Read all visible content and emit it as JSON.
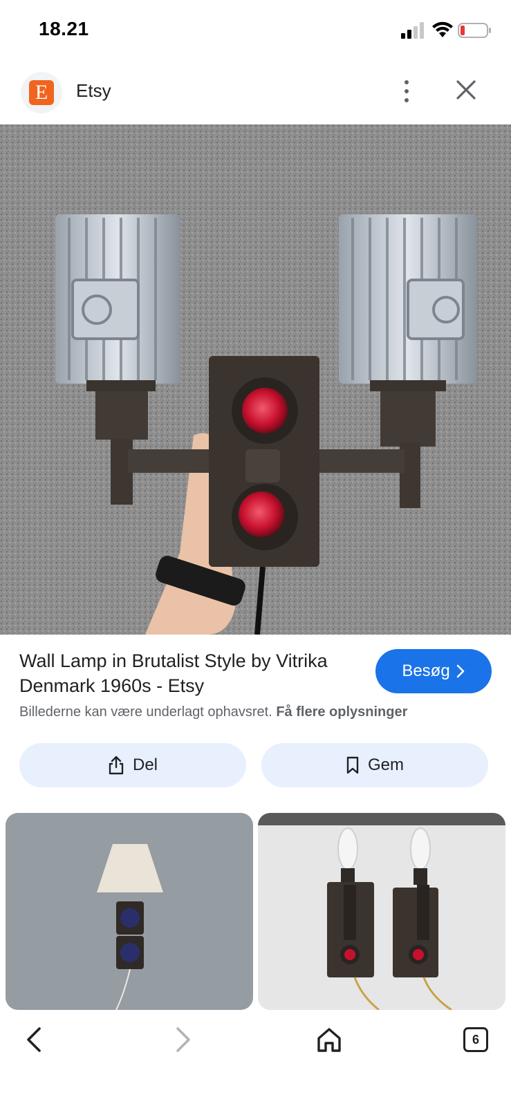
{
  "status": {
    "time": "18.21"
  },
  "header": {
    "logo_letter": "E",
    "site_name": "Etsy"
  },
  "result": {
    "title": "Wall Lamp in Brutalist Style by Vitrika Denmark 1960s - Etsy",
    "visit_label": "Besøg",
    "copyright_text": "Billederne kan være underlagt ophavsret.",
    "more_info_label": "Få flere oplysninger"
  },
  "actions": {
    "share_label": "Del",
    "save_label": "Gem"
  },
  "nav": {
    "tab_count": "6"
  },
  "colors": {
    "accent": "#1a73e8",
    "action_bg": "#e8f0fe",
    "etsy_orange": "#f1641e",
    "lens_red": "#c8102e"
  },
  "icons": [
    "signal-icon",
    "wifi-icon",
    "battery-icon",
    "more-vert-icon",
    "close-icon",
    "chevron-right-icon",
    "share-icon",
    "bookmark-icon",
    "back-icon",
    "forward-icon",
    "home-icon",
    "tabs-icon"
  ]
}
